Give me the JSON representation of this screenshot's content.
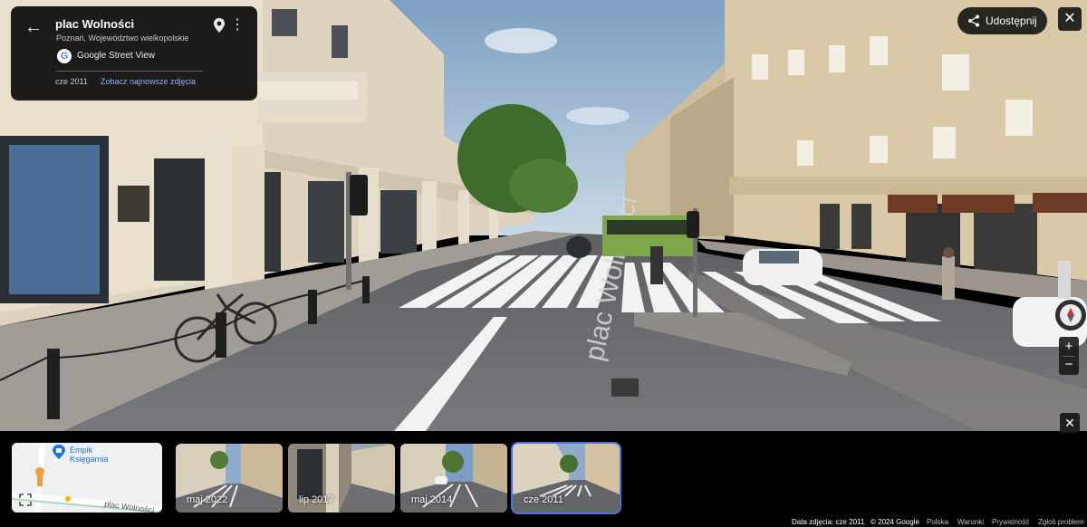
{
  "place": {
    "title": "plac Wolności",
    "subtitle": "Poznań, Województwo wielkopolskie",
    "service": "Google Street View",
    "capture_date": "cze 2011",
    "latest_link": "Zobacz najnowsze zdjęcia"
  },
  "share": {
    "label": "Udostępnij"
  },
  "scene": {
    "street_text": "plac Wolności"
  },
  "minimap": {
    "place_label_line1": "Empik",
    "place_label_line2": "Księgarnia",
    "street_label": "plac Wolności"
  },
  "history": [
    {
      "label": "maj 2022",
      "selected": false
    },
    {
      "label": "lip 2017",
      "selected": false
    },
    {
      "label": "maj 2014",
      "selected": false
    },
    {
      "label": "cze 2011",
      "selected": true
    }
  ],
  "footer": {
    "photo_date": "Data zdjęcia: cze 2011",
    "copyright": "© 2024 Google",
    "country": "Polska",
    "terms": "Warunki",
    "privacy": "Prywatność",
    "report": "Zgłoś problem"
  },
  "colors": {
    "accent": "#8ab4f8",
    "selected_outline": "#4a74d8",
    "panel": "#0a0a0a"
  },
  "icons": [
    "back-arrow-icon",
    "location-pin-icon",
    "more-vert-icon",
    "google-logo-icon",
    "share-icon",
    "close-icon",
    "compass-icon",
    "zoom-in-icon",
    "zoom-out-icon",
    "expand-icon"
  ]
}
